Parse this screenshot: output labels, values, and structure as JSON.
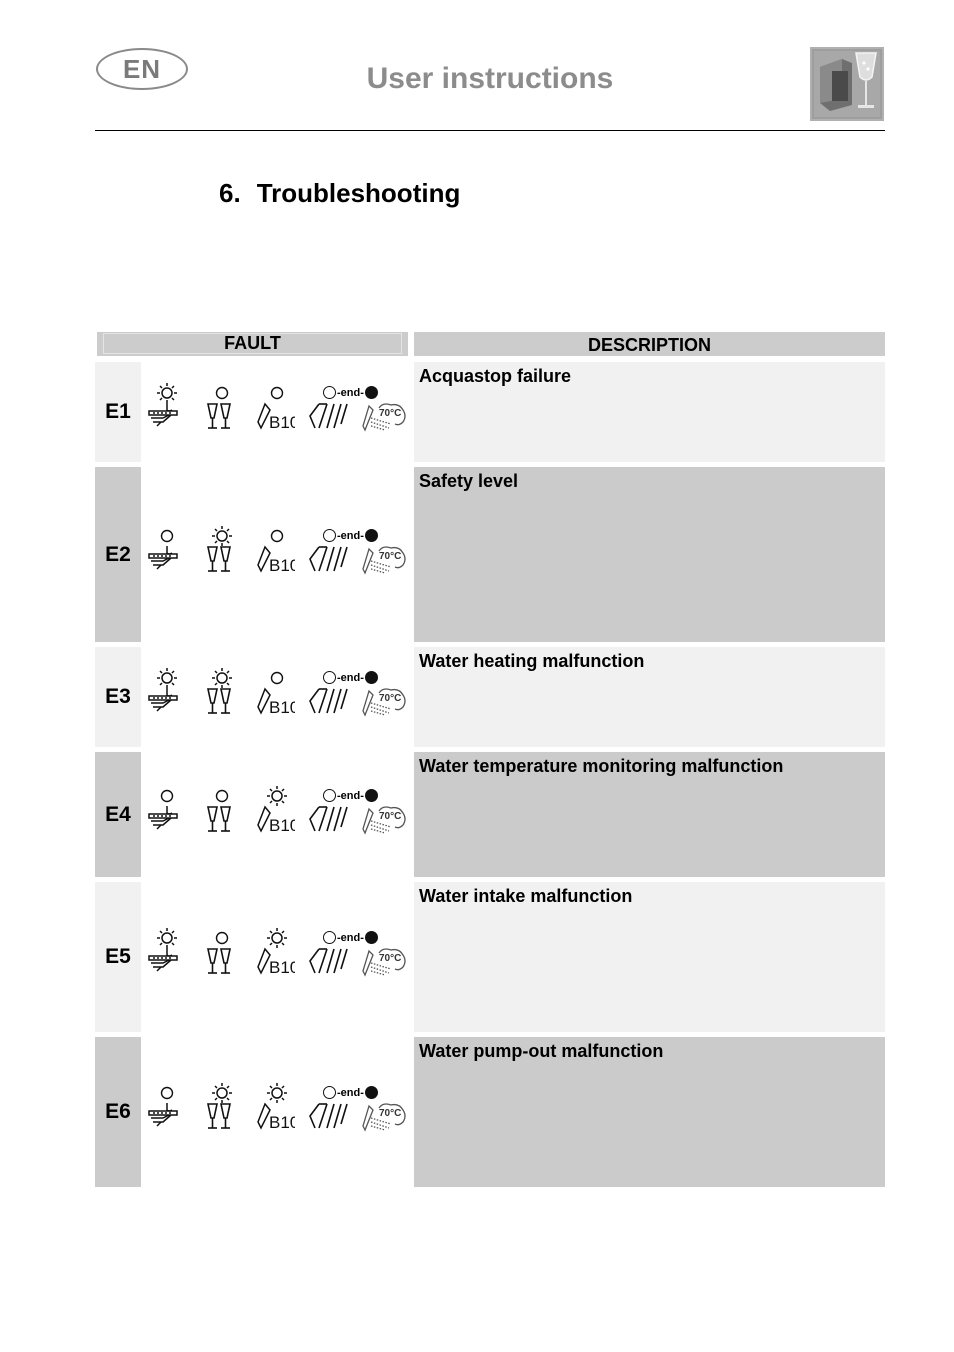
{
  "header": {
    "language_badge": "EN",
    "title": "User instructions",
    "logo_icon": "dishwasher-glass-icon"
  },
  "section": {
    "number": "6.",
    "title": "Troubleshooting"
  },
  "table": {
    "headers": {
      "fault": "FAULT",
      "description": "DESCRIPTION"
    },
    "indicator_labels": {
      "end_sequence": "-end-",
      "temperature": "70°C"
    },
    "programme_symbols": [
      "prewash-icon",
      "glasses-icon",
      "bio-icon",
      "wash-plates-icon",
      "hot-wash-70-icon"
    ],
    "rows": [
      {
        "code": "E1",
        "description": "Acquastop failure",
        "indicators": [
          "on",
          "off",
          "off"
        ],
        "shade": "light"
      },
      {
        "code": "E2",
        "description": "Safety level",
        "indicators": [
          "off",
          "on",
          "off"
        ],
        "shade": "dark"
      },
      {
        "code": "E3",
        "description": "Water heating malfunction",
        "indicators": [
          "on",
          "on",
          "off"
        ],
        "shade": "light"
      },
      {
        "code": "E4",
        "description": "Water temperature monitoring malfunction",
        "indicators": [
          "off",
          "off",
          "on"
        ],
        "shade": "dark"
      },
      {
        "code": "E5",
        "description": "Water intake malfunction",
        "indicators": [
          "on",
          "off",
          "on"
        ],
        "shade": "light"
      },
      {
        "code": "E6",
        "description": "Water pump-out malfunction",
        "indicators": [
          "off",
          "on",
          "on"
        ],
        "shade": "dark"
      }
    ]
  }
}
